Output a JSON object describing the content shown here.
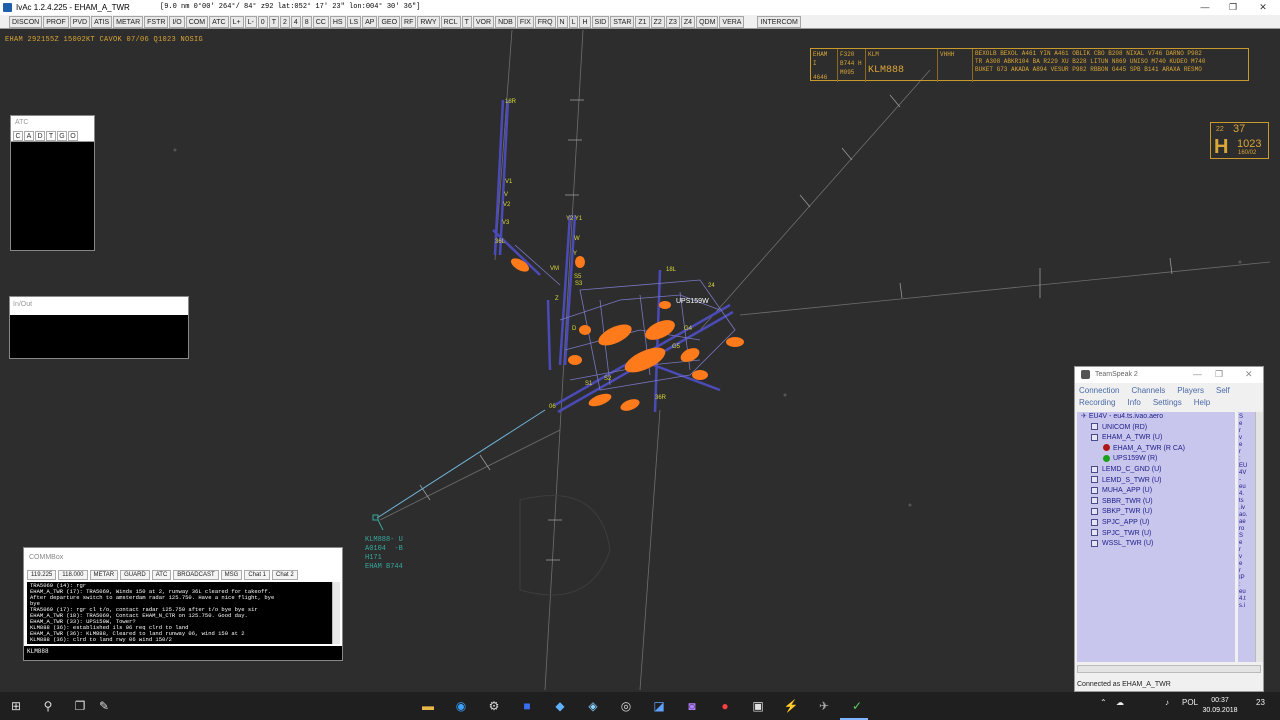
{
  "window": {
    "title": "IvAc 1.2.4.225 - EHAM_A_TWR",
    "coords": "[9.0 nm   0°00'   264°/ 84°   z92   lat:052° 17' 23\" lon:004° 30' 36\"]",
    "min_icon": "—",
    "max_icon": "❐",
    "close_icon": "✕"
  },
  "toolbar": {
    "buttons": [
      "DISCON",
      "PROF",
      "PVD",
      "ATIS",
      "METAR",
      "FSTR",
      "I/O",
      "COM",
      "ATC",
      "L+",
      "L-",
      "0",
      "T",
      "2",
      "4",
      "8",
      "CC",
      "HS",
      "LS",
      "AP",
      "GEO",
      "RF",
      "RWY",
      "RCL",
      "T",
      "VOR",
      "NDB",
      "FIX",
      "FRQ",
      "N",
      "L",
      "H",
      "SID",
      "STAR",
      "Z1",
      "Z2",
      "Z3",
      "Z4",
      "QDM",
      "VERA",
      "INTERCOM"
    ]
  },
  "scope": {
    "metar": "EHAM 292155Z 15002KT CAVOK 07/06 Q1023 NOSIG",
    "runway_labels": [
      "18R",
      "36L",
      "36R",
      "18C",
      "06",
      "24",
      "22",
      "04",
      "09",
      "27"
    ],
    "taxi_labels": [
      "V1",
      "V",
      "V2",
      "V3",
      "A",
      "B",
      "C",
      "D",
      "E",
      "F",
      "G",
      "H",
      "J",
      "K",
      "Z",
      "W",
      "Y",
      "S1",
      "S2",
      "S3",
      "G4",
      "G5",
      "B2",
      "C3",
      "D4"
    ],
    "target_callsign": "UPS159W"
  },
  "strip": {
    "origin": "EHAM",
    "level": "F320",
    "airline": "KLM",
    "dest": "VHHH",
    "type": "B744",
    "type_suffix": "H",
    "code": "M095",
    "squawk": "4646",
    "sector": "I",
    "callsign": "KLM888",
    "route_line1": "BEXOLB BEXOL A461 YIN A461 OBLIK CBO B208 NIXAL V746 DARNO P982",
    "route_line2": "TR A308 ABKR104 BA R229 XU B228 LITUN N869 UNISO M740 KUDEO M740",
    "route_line3": "BUKET G73 AKADA A894 VESUR P982 RBBON G445 SPB B141 ARAXA RESMO"
  },
  "qnh": {
    "time_small": "22",
    "time_big": "37",
    "pressure_symbol": "H",
    "qnh": "1023",
    "wind": "160/02"
  },
  "atc_window": {
    "title": "ATC",
    "tabs": [
      "C",
      "A",
      "D",
      "T",
      "G",
      "O"
    ]
  },
  "inout_window": {
    "title": "In/Out"
  },
  "aircraft_label": {
    "line1": "KLM888- U",
    "line2": "A0104  -B",
    "line3": "H171",
    "line4": "EHAM B744"
  },
  "commbox": {
    "title": "COMMBox",
    "tabs": [
      "119.225",
      "118.000",
      "METAR",
      "GUARD",
      "ATC",
      "BROADCAST",
      "MSG",
      "Chat 1",
      "Chat 2"
    ],
    "messages": [
      "TRA5069 (14): rgr",
      "EHAM_A_TWR (17): TRA5069, Winds 150 at 2, runway 36L cleared for takeoff.",
      "After departure switch to amsterdam radar 125.750. Have a nice flight, bye",
      "bye",
      "TRA5069 (17): rgr cl t/o, contact radar 125.750 after t/o bye bye sir",
      "EHAM_A_TWR (18): TRA5069, Contact EHAM_N_CTR on 125.750. Good day.",
      "EHAM_A_TWR (33): UPS159W, Tower?",
      "KLM888 (36): established ils 06 req clrd to land",
      "EHAM_A_TWR (36): KLM888, Cleared to land runway 06, wind 150 at 2",
      "KLM888 (36): clrd to land rwy 06 wind 150/2"
    ],
    "input_value": "KLM888"
  },
  "teamspeak": {
    "title": "TeamSpeak 2",
    "menu_row1": [
      "Connection",
      "Channels",
      "Players",
      "Self"
    ],
    "menu_row2": [
      "Recording",
      "Info",
      "Settings",
      "Help"
    ],
    "server": "EU4V - eu4.ts.ivao.aero",
    "channels": [
      {
        "name": "UNICOM   (RD)",
        "indent": 1,
        "kind": "channel"
      },
      {
        "name": "EHAM_A_TWR   (U)",
        "indent": 1,
        "kind": "channel"
      },
      {
        "name": "EHAM_A_TWR (R CA)",
        "indent": 2,
        "kind": "user-red"
      },
      {
        "name": "UPS159W  (R)",
        "indent": 2,
        "kind": "user-green"
      },
      {
        "name": "LEMD_C_GND   (U)",
        "indent": 1,
        "kind": "channel"
      },
      {
        "name": "LEMD_S_TWR   (U)",
        "indent": 1,
        "kind": "channel"
      },
      {
        "name": "MUHA_APP   (U)",
        "indent": 1,
        "kind": "channel"
      },
      {
        "name": "SBBR_TWR   (U)",
        "indent": 1,
        "kind": "channel"
      },
      {
        "name": "SBKP_TWR   (U)",
        "indent": 1,
        "kind": "channel"
      },
      {
        "name": "SPJC_APP   (U)",
        "indent": 1,
        "kind": "channel"
      },
      {
        "name": "SPJC_TWR   (U)",
        "indent": 1,
        "kind": "channel"
      },
      {
        "name": "WSSL_TWR   (U)",
        "indent": 1,
        "kind": "channel"
      }
    ],
    "side_info": "S\ne\nr\nv\ne\nr\n:\nEU\n4V\n- \neu\n4.\nts\n.iv\nao.\nae\nro\nS\ne\nr\nv\ne\nr\nIP\n:\neu\n4.t\ns.i",
    "status": "Connected as EHAM_A_TWR"
  },
  "taskbar": {
    "time": "00:37",
    "date": "30.09.2018",
    "lang": "POL",
    "notif": "23"
  }
}
